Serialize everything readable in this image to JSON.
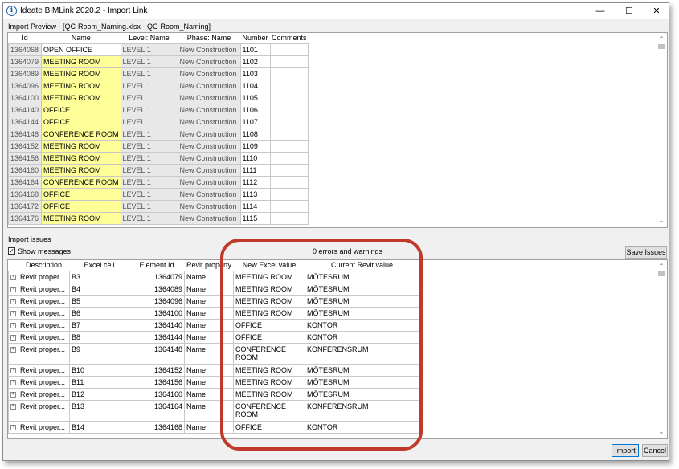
{
  "window": {
    "title": "Ideate BIMLink 2020.2 - Import Link",
    "min_icon": "minimize-icon",
    "max_icon": "maximize-icon",
    "close_icon": "close-icon"
  },
  "preview": {
    "label": "Import Preview - [QC-Room_Naming.xlsx - QC-Room_Naming]",
    "columns": [
      "Id",
      "Name",
      "Level: Name",
      "Phase: Name",
      "Number",
      "Comments"
    ],
    "rows": [
      {
        "id": "1364068",
        "name": "OPEN OFFICE",
        "level": "LEVEL 1",
        "phase": "New Construction",
        "number": "1101",
        "comments": "",
        "hl": false
      },
      {
        "id": "1364079",
        "name": "MEETING ROOM",
        "level": "LEVEL 1",
        "phase": "New Construction",
        "number": "1102",
        "comments": "",
        "hl": true
      },
      {
        "id": "1364089",
        "name": "MEETING ROOM",
        "level": "LEVEL 1",
        "phase": "New Construction",
        "number": "1103",
        "comments": "",
        "hl": true
      },
      {
        "id": "1364096",
        "name": "MEETING ROOM",
        "level": "LEVEL 1",
        "phase": "New Construction",
        "number": "1104",
        "comments": "",
        "hl": true
      },
      {
        "id": "1364100",
        "name": "MEETING ROOM",
        "level": "LEVEL 1",
        "phase": "New Construction",
        "number": "1105",
        "comments": "",
        "hl": true
      },
      {
        "id": "1364140",
        "name": "OFFICE",
        "level": "LEVEL 1",
        "phase": "New Construction",
        "number": "1106",
        "comments": "",
        "hl": true
      },
      {
        "id": "1364144",
        "name": "OFFICE",
        "level": "LEVEL 1",
        "phase": "New Construction",
        "number": "1107",
        "comments": "",
        "hl": true
      },
      {
        "id": "1364148",
        "name": "CONFERENCE ROOM",
        "level": "LEVEL 1",
        "phase": "New Construction",
        "number": "1108",
        "comments": "",
        "hl": true
      },
      {
        "id": "1364152",
        "name": "MEETING ROOM",
        "level": "LEVEL 1",
        "phase": "New Construction",
        "number": "1109",
        "comments": "",
        "hl": true
      },
      {
        "id": "1364156",
        "name": "MEETING ROOM",
        "level": "LEVEL 1",
        "phase": "New Construction",
        "number": "1110",
        "comments": "",
        "hl": true
      },
      {
        "id": "1364160",
        "name": "MEETING ROOM",
        "level": "LEVEL 1",
        "phase": "New Construction",
        "number": "1111",
        "comments": "",
        "hl": true
      },
      {
        "id": "1364164",
        "name": "CONFERENCE ROOM",
        "level": "LEVEL 1",
        "phase": "New Construction",
        "number": "1112",
        "comments": "",
        "hl": true
      },
      {
        "id": "1364168",
        "name": "OFFICE",
        "level": "LEVEL 1",
        "phase": "New Construction",
        "number": "1113",
        "comments": "",
        "hl": true
      },
      {
        "id": "1364172",
        "name": "OFFICE",
        "level": "LEVEL 1",
        "phase": "New Construction",
        "number": "1114",
        "comments": "",
        "hl": true
      },
      {
        "id": "1364176",
        "name": "MEETING ROOM",
        "level": "LEVEL 1",
        "phase": "New Construction",
        "number": "1115",
        "comments": "",
        "hl": true
      }
    ]
  },
  "issues": {
    "label": "Import issues",
    "show_messages_label": "Show messages",
    "show_messages_checked": true,
    "status": "0 errors and warnings",
    "save_issues_label": "Save Issues",
    "columns": [
      "Description",
      "Excel cell",
      "Element Id",
      "Revit property",
      "New Excel value",
      "Current Revit value"
    ],
    "rows": [
      {
        "desc": "Revit proper...",
        "cell": "B3",
        "elem": "1364079",
        "prop": "Name",
        "new_val": "MEETING ROOM",
        "cur_val": "MÖTESRUM",
        "tall": false
      },
      {
        "desc": "Revit proper...",
        "cell": "B4",
        "elem": "1364089",
        "prop": "Name",
        "new_val": "MEETING ROOM",
        "cur_val": "MÖTESRUM",
        "tall": false
      },
      {
        "desc": "Revit proper...",
        "cell": "B5",
        "elem": "1364096",
        "prop": "Name",
        "new_val": "MEETING ROOM",
        "cur_val": "MÖTESRUM",
        "tall": false
      },
      {
        "desc": "Revit proper...",
        "cell": "B6",
        "elem": "1364100",
        "prop": "Name",
        "new_val": "MEETING ROOM",
        "cur_val": "MÖTESRUM",
        "tall": false
      },
      {
        "desc": "Revit proper...",
        "cell": "B7",
        "elem": "1364140",
        "prop": "Name",
        "new_val": "OFFICE",
        "cur_val": "KONTOR",
        "tall": false
      },
      {
        "desc": "Revit proper...",
        "cell": "B8",
        "elem": "1364144",
        "prop": "Name",
        "new_val": "OFFICE",
        "cur_val": "KONTOR",
        "tall": false
      },
      {
        "desc": "Revit proper...",
        "cell": "B9",
        "elem": "1364148",
        "prop": "Name",
        "new_val": "CONFERENCE ROOM",
        "cur_val": "KONFERENSRUM",
        "tall": true
      },
      {
        "desc": "Revit proper...",
        "cell": "B10",
        "elem": "1364152",
        "prop": "Name",
        "new_val": "MEETING ROOM",
        "cur_val": "MÖTESRUM",
        "tall": false
      },
      {
        "desc": "Revit proper...",
        "cell": "B11",
        "elem": "1364156",
        "prop": "Name",
        "new_val": "MEETING ROOM",
        "cur_val": "MÖTESRUM",
        "tall": false
      },
      {
        "desc": "Revit proper...",
        "cell": "B12",
        "elem": "1364160",
        "prop": "Name",
        "new_val": "MEETING ROOM",
        "cur_val": "MÖTESRUM",
        "tall": false
      },
      {
        "desc": "Revit proper...",
        "cell": "B13",
        "elem": "1364164",
        "prop": "Name",
        "new_val": "CONFERENCE ROOM",
        "cur_val": "KONFERENSRUM",
        "tall": true
      },
      {
        "desc": "Revit proper...",
        "cell": "B14",
        "elem": "1364168",
        "prop": "Name",
        "new_val": "OFFICE",
        "cur_val": "KONTOR",
        "tall": false
      }
    ]
  },
  "footer": {
    "import_label": "Import",
    "cancel_label": "Cancel"
  },
  "colors": {
    "highlight": "#ffff99",
    "annotation": "#c0392b",
    "accent": "#0078d7"
  }
}
